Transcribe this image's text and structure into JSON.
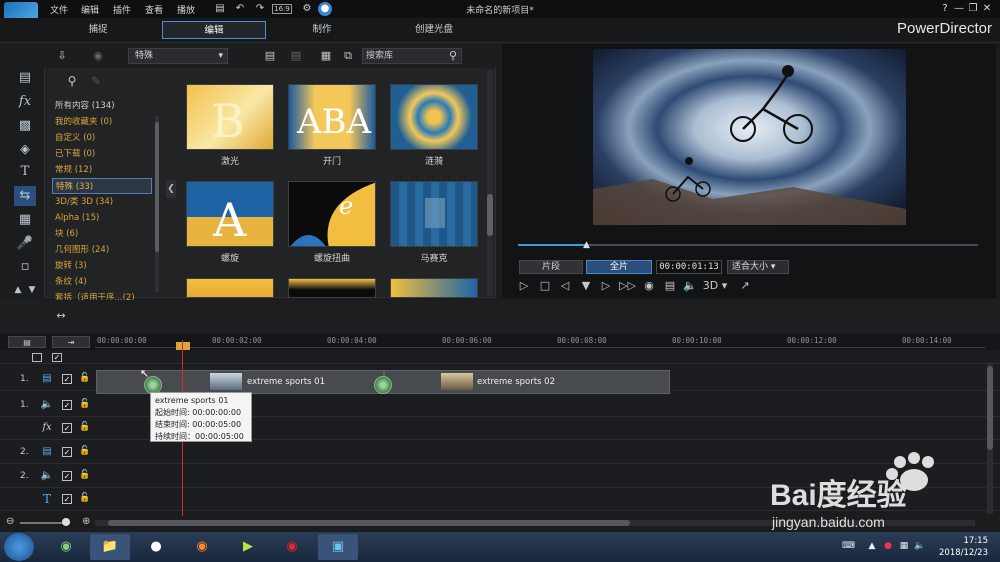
{
  "menu": [
    "文件",
    "编辑",
    "插件",
    "查看",
    "播放"
  ],
  "document_title": "未命名的新项目*",
  "modes": [
    "捕捉",
    "编辑",
    "制作",
    "创建光盘"
  ],
  "brand": "PowerDirector",
  "toolbar_icons": [
    "save-icon",
    "undo-icon",
    "redo-icon",
    "aspect-icon",
    "settings-icon",
    "account-icon"
  ],
  "aspect_label": "16:9",
  "library": {
    "category_selected": "特殊",
    "search_placeholder": "搜索库",
    "categories": [
      {
        "label": "所有内容 (134)",
        "style": "white"
      },
      {
        "label": "我的收藏夹 (0)",
        "style": "gold"
      },
      {
        "label": "自定义 (0)",
        "style": "gold"
      },
      {
        "label": "已下载 (0)",
        "style": "gold"
      },
      {
        "label": "常规 (12)",
        "style": "gold"
      },
      {
        "label": "特殊 (33)",
        "style": "active"
      },
      {
        "label": "3D/类 3D (34)",
        "style": "gold"
      },
      {
        "label": "Alpha (15)",
        "style": "gold"
      },
      {
        "label": "块 (6)",
        "style": "gold"
      },
      {
        "label": "几何图形 (24)",
        "style": "gold"
      },
      {
        "label": "旋转 (3)",
        "style": "gold"
      },
      {
        "label": "条纹 (4)",
        "style": "gold"
      },
      {
        "label": "套括（适用于序...(2)",
        "style": "gold"
      }
    ],
    "effects": [
      "激光",
      "开门",
      "涟漪",
      "螺旋",
      "螺旋扭曲",
      "马赛克"
    ]
  },
  "preview": {
    "clip_tab": "片段",
    "movie_tab": "全片",
    "timecode": "00:00:01:13",
    "fit": "适合大小",
    "mode_3d": "3D",
    "seek_progress": 0.153
  },
  "timeline": {
    "ruler": [
      "00:00:00:00",
      "00:00:02:00",
      "00:00:04:00",
      "00:00:06:00",
      "00:00:08:00",
      "00:00:10:00",
      "00:00:12:00",
      "00:00:14:00"
    ],
    "tracks": [
      {
        "num": "1.",
        "icon": "video-track-icon"
      },
      {
        "num": "1.",
        "icon": "audio-track-icon"
      },
      {
        "num": "",
        "icon": "fx-track-icon"
      },
      {
        "num": "2.",
        "icon": "video-track-icon"
      },
      {
        "num": "2.",
        "icon": "audio-track-icon"
      },
      {
        "num": "",
        "icon": "title-track-icon"
      }
    ],
    "clips": [
      "extreme sports 01",
      "extreme sports 02"
    ],
    "tooltip": {
      "title": "extreme sports 01",
      "start": "起始时间: 00:00:00:00",
      "end": "结束时间: 00:00:05:00",
      "duration": "持续时间：00:00:05:00"
    }
  },
  "taskbar": {
    "time": "17:15",
    "date": "2018/12/23"
  },
  "watermark": {
    "text": "Bai度经验",
    "url": "jingyan.baidu.com"
  }
}
